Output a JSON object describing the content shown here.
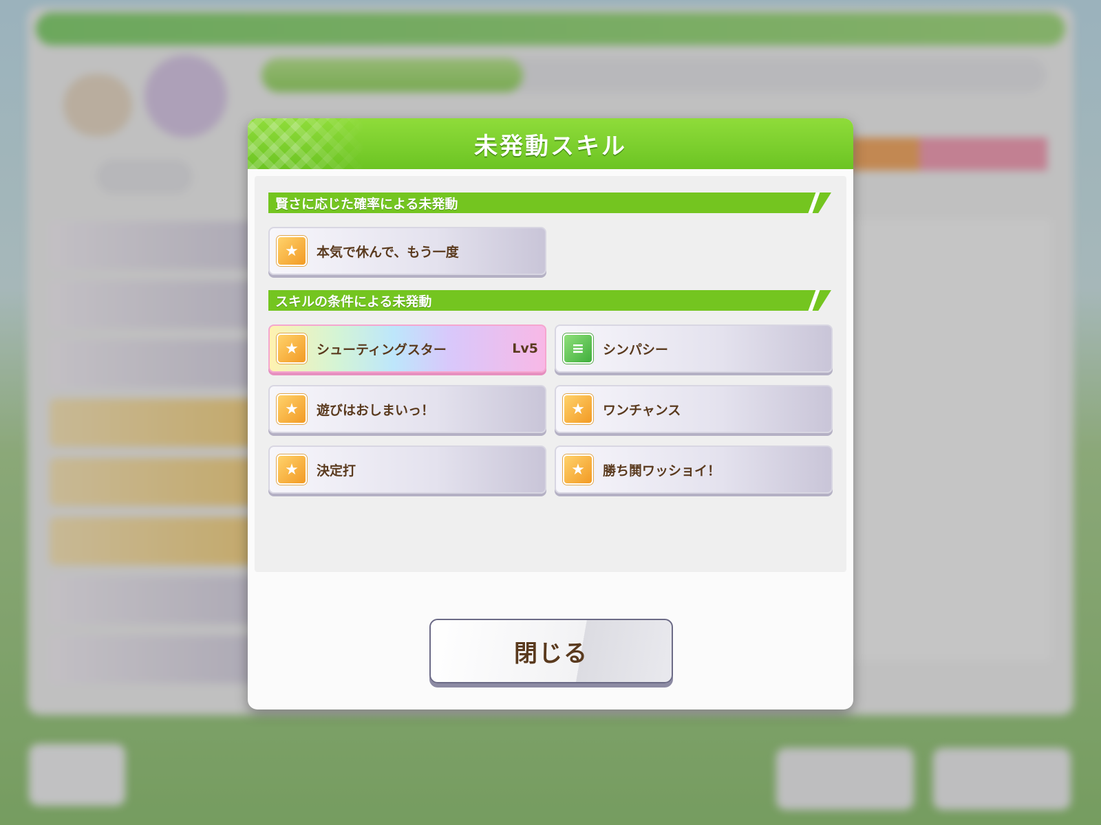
{
  "dialog": {
    "title": "未発動スキル",
    "sections": [
      {
        "label": "賢さに応じた確率による未発動",
        "skills": [
          {
            "name": "本気で休んで、もう一度",
            "level": "",
            "icon": "running-figure-icon",
            "style": "normal"
          }
        ]
      },
      {
        "label": "スキルの条件による未発動",
        "skills": [
          {
            "name": "シューティングスター",
            "level": "Lv5",
            "icon": "running-figure-icon",
            "style": "rainbow"
          },
          {
            "name": "シンパシー",
            "level": "",
            "icon": "document-icon",
            "style": "green"
          },
          {
            "name": "遊びはおしまいっ！",
            "level": "",
            "icon": "running-figure-icon",
            "style": "normal"
          },
          {
            "name": "ワンチャンス",
            "level": "",
            "icon": "running-figure-icon",
            "style": "normal"
          },
          {
            "name": "決定打",
            "level": "",
            "icon": "running-figure-icon",
            "style": "normal"
          },
          {
            "name": "勝ち鬨ワッショイ！",
            "level": "",
            "icon": "running-figure-icon",
            "style": "normal"
          }
        ]
      }
    ],
    "close_label": "閉じる"
  },
  "colors": {
    "header_green": "#6cc423",
    "section_green": "#74c520",
    "text_brown": "#5a3a1e",
    "rainbow_border": "#f5a6cf"
  }
}
